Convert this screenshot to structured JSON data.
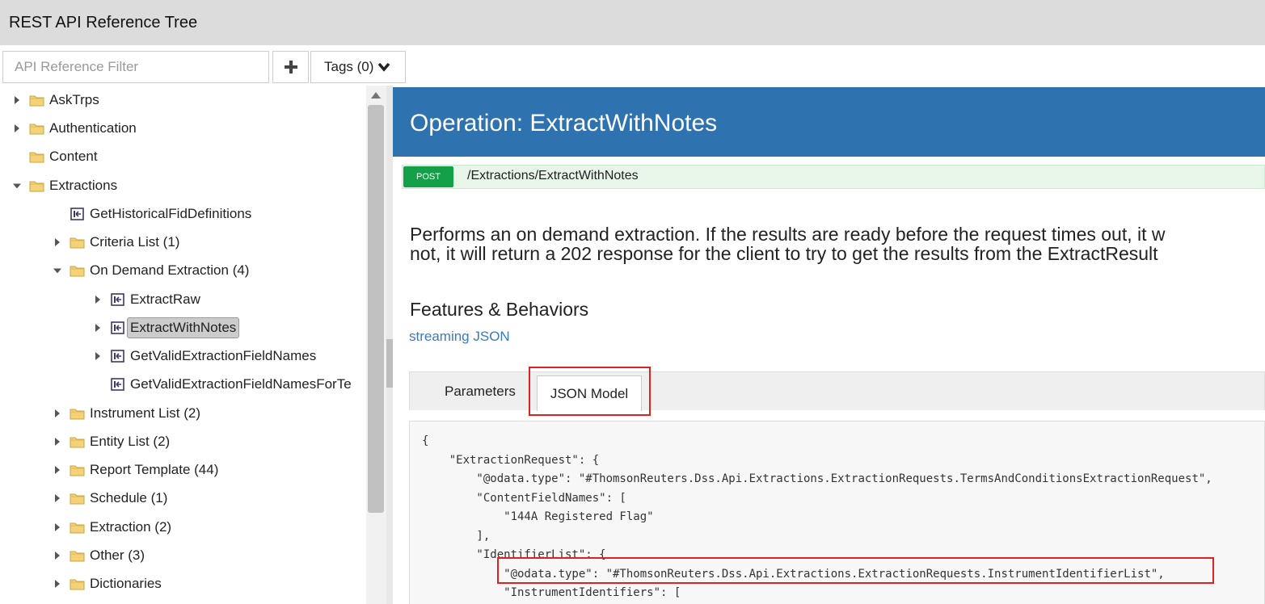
{
  "app": {
    "title": "REST API Reference Tree"
  },
  "filter": {
    "placeholder": "API Reference Filter",
    "tags_label": "Tags (0)"
  },
  "tree": {
    "items": [
      {
        "label": "AskTrps"
      },
      {
        "label": "Authentication"
      },
      {
        "label": "Content"
      },
      {
        "label": "Extractions"
      },
      {
        "label": "GetHistoricalFidDefinitions"
      },
      {
        "label": "Criteria List (1)"
      },
      {
        "label": "On Demand Extraction (4)"
      },
      {
        "label": "ExtractRaw"
      },
      {
        "label": "ExtractWithNotes"
      },
      {
        "label": "GetValidExtractionFieldNames"
      },
      {
        "label": "GetValidExtractionFieldNamesForTe"
      },
      {
        "label": "Instrument List (2)"
      },
      {
        "label": "Entity List (2)"
      },
      {
        "label": "Report Template (44)"
      },
      {
        "label": "Schedule (1)"
      },
      {
        "label": "Extraction (2)"
      },
      {
        "label": "Other (3)"
      },
      {
        "label": "Dictionaries"
      }
    ]
  },
  "operation": {
    "title": "Operation: ExtractWithNotes",
    "method": "POST",
    "path": "/Extractions/ExtractWithNotes",
    "description_line1": "Performs an on demand extraction. If the results are ready before the request times out, it w",
    "description_line2": "not, it will return a 202 response for the client to try to get the results from the ExtractResult",
    "features_title": "Features & Behaviors",
    "features_link": "streaming JSON"
  },
  "tabs": {
    "parameters": "Parameters",
    "json_model": "JSON Model"
  },
  "json_model": {
    "lines": [
      "{",
      "    \"ExtractionRequest\": {",
      "        \"@odata.type\": \"#ThomsonReuters.Dss.Api.Extractions.ExtractionRequests.TermsAndConditionsExtractionRequest\",",
      "        \"ContentFieldNames\": [",
      "            \"144A Registered Flag\"",
      "        ],",
      "        \"IdentifierList\": {",
      "            \"@odata.type\": \"#ThomsonReuters.Dss.Api.Extractions.ExtractionRequests.InstrumentIdentifierList\",",
      "            \"InstrumentIdentifiers\": ["
    ]
  }
}
